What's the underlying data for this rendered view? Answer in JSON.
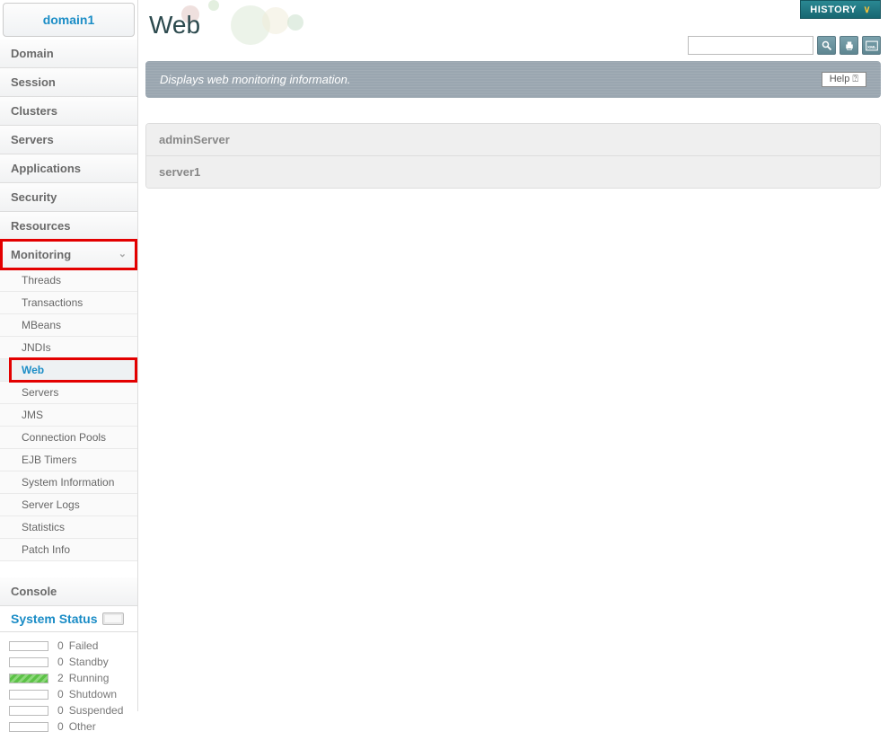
{
  "domain": "domain1",
  "nav": {
    "items": [
      "Domain",
      "Session",
      "Clusters",
      "Servers",
      "Applications",
      "Security",
      "Resources"
    ],
    "monitoring": {
      "label": "Monitoring",
      "subitems": [
        "Threads",
        "Transactions",
        "MBeans",
        "JNDIs",
        "Web",
        "Servers",
        "JMS",
        "Connection Pools",
        "EJB Timers",
        "System Information",
        "Server Logs",
        "Statistics",
        "Patch Info"
      ],
      "active": "Web"
    },
    "console": "Console"
  },
  "system_status": {
    "title": "System Status",
    "rows": [
      {
        "count": 0,
        "label": "Failed",
        "running": false
      },
      {
        "count": 0,
        "label": "Standby",
        "running": false
      },
      {
        "count": 2,
        "label": "Running",
        "running": true
      },
      {
        "count": 0,
        "label": "Shutdown",
        "running": false
      },
      {
        "count": 0,
        "label": "Suspended",
        "running": false
      },
      {
        "count": 0,
        "label": "Other",
        "running": false
      }
    ]
  },
  "header": {
    "title": "Web",
    "history": "HISTORY",
    "search_placeholder": ""
  },
  "banner": {
    "text": "Displays web monitoring information.",
    "help": "Help"
  },
  "servers": [
    {
      "name": "adminServer"
    },
    {
      "name": "server1"
    }
  ]
}
